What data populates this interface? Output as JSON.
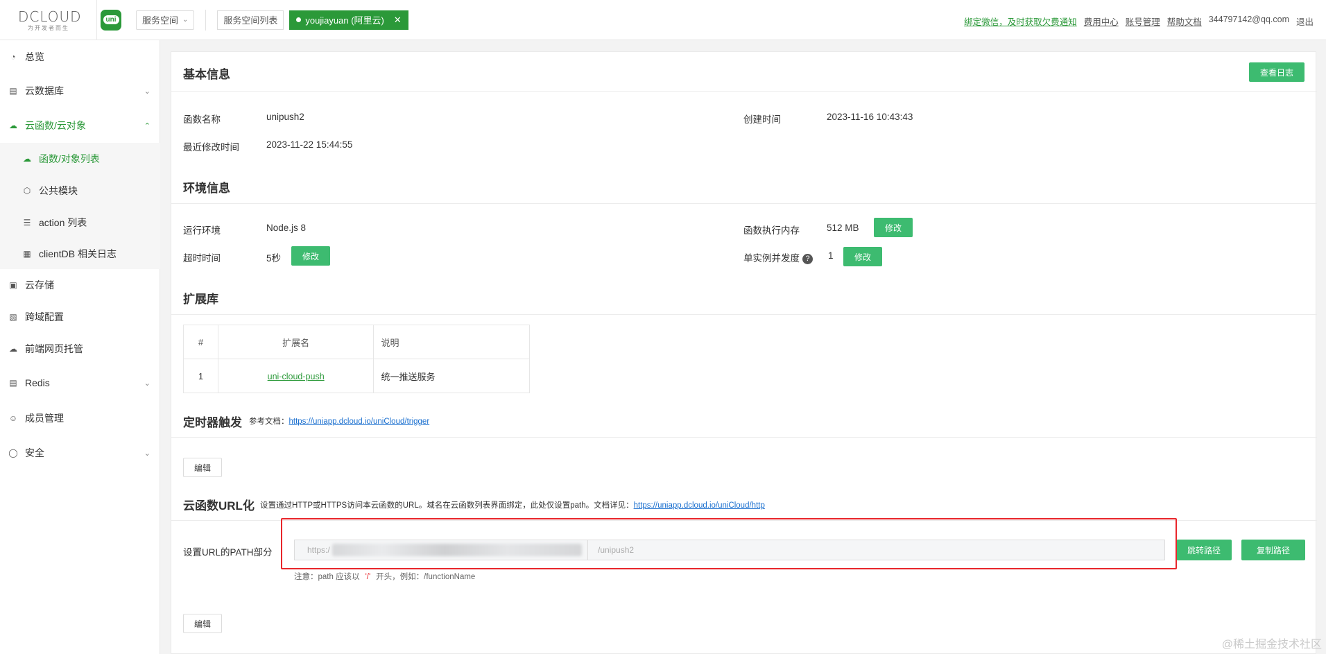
{
  "topbar": {
    "brand": "DCLOUD",
    "slogan": "为开发者而生",
    "uni_badge": "uni",
    "space_select": "服务空间",
    "space_list_button": "服务空间列表",
    "active_space": "youjiayuan (阿里云)",
    "links": {
      "bind_wechat": "绑定微信，及时获取欠费通知",
      "billing": "费用中心",
      "account": "账号管理",
      "help": "帮助文档",
      "email": "344797142@qq.com",
      "logout": "退出"
    }
  },
  "sidebar": {
    "items": {
      "overview": "总览",
      "database": "云数据库",
      "functions": "云函数/云对象",
      "storage": "云存储",
      "cors": "跨域配置",
      "hosting": "前端网页托管",
      "redis": "Redis",
      "members": "成员管理",
      "security": "安全"
    },
    "sub_items": {
      "function_list": "函数/对象列表",
      "common_modules": "公共模块",
      "action_list": "action 列表",
      "clientdb_logs": "clientDB 相关日志"
    }
  },
  "basic": {
    "title": "基本信息",
    "view_logs": "查看日志",
    "name_label": "函数名称",
    "name_value": "unipush2",
    "created_label": "创建时间",
    "created_value": "2023-11-16 10:43:43",
    "modified_label": "最近修改时间",
    "modified_value": "2023-11-22 15:44:55"
  },
  "env": {
    "title": "环境信息",
    "runtime_label": "运行环境",
    "runtime_value": "Node.js 8",
    "memory_label": "函数执行内存",
    "memory_value": "512 MB",
    "timeout_label": "超时时间",
    "timeout_value": "5秒",
    "concurrency_label": "单实例并发度",
    "concurrency_value": "1",
    "help_glyph": "?",
    "modify": "修改"
  },
  "ext": {
    "title": "扩展库",
    "headers": [
      "#",
      "扩展名",
      "说明"
    ],
    "rows": [
      {
        "index": "1",
        "name": "uni-cloud-push",
        "desc": "统一推送服务"
      }
    ]
  },
  "trigger": {
    "title": "定时器触发",
    "ref_label": "参考文档：",
    "ref_link": "https://uniapp.dcloud.io/uniCloud/trigger",
    "edit": "编辑"
  },
  "url": {
    "title": "云函数URL化",
    "desc": "设置通过HTTP或HTTPS访问本云函数的URL。域名在云函数列表界面绑定，此处仅设置path。文档详见：",
    "doc_link": "https://uniapp.dcloud.io/uniCloud/http",
    "path_label": "设置URL的PATH部分",
    "prefix": "https:/",
    "path_placeholder": "/unipush2",
    "jump": "跳转路径",
    "copy": "复制路径",
    "note_prefix": "注意：path 应该以",
    "note_slash": "'/'",
    "note_suffix": "开头，例如：/functionName",
    "edit": "编辑"
  },
  "watermark": "@稀土掘金技术社区",
  "colors": {
    "accent": "#2b9939",
    "button_green": "#3dbb70",
    "highlight_red": "#e8262b",
    "link_blue": "#1a6fcf"
  }
}
